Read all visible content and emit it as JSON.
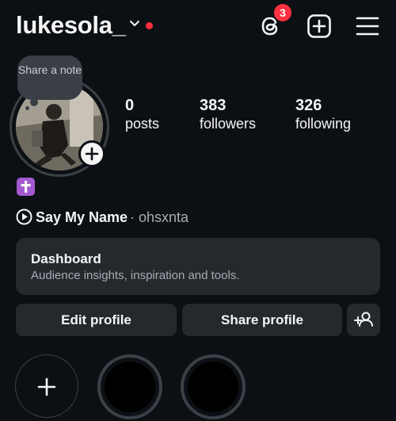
{
  "header": {
    "username": "lukesola_",
    "threads_badge_count": "3",
    "icons": [
      "chevron-down-icon",
      "threads-icon",
      "add-post-icon",
      "menu-icon"
    ],
    "red_dot_color": "#ff3040"
  },
  "note": {
    "text": "Share a note"
  },
  "stats": [
    {
      "value": "0",
      "label": "posts"
    },
    {
      "value": "383",
      "label": "followers"
    },
    {
      "value": "326",
      "label": "following"
    }
  ],
  "bio": {
    "emoji": "cross-emoji"
  },
  "music": {
    "song": "Say My Name",
    "separator": "·",
    "artist": "ohsxnta"
  },
  "dashboard": {
    "title": "Dashboard",
    "subtitle": "Audience insights, inspiration and tools."
  },
  "actions": {
    "edit_profile": "Edit profile",
    "share_profile": "Share profile",
    "discover_people_icon": "add-person-icon"
  },
  "highlights": {
    "new_icon": "plus-icon",
    "items": 2
  },
  "colors": {
    "background": "#0c1014",
    "card": "#25292e",
    "accent": "#ff3040"
  }
}
